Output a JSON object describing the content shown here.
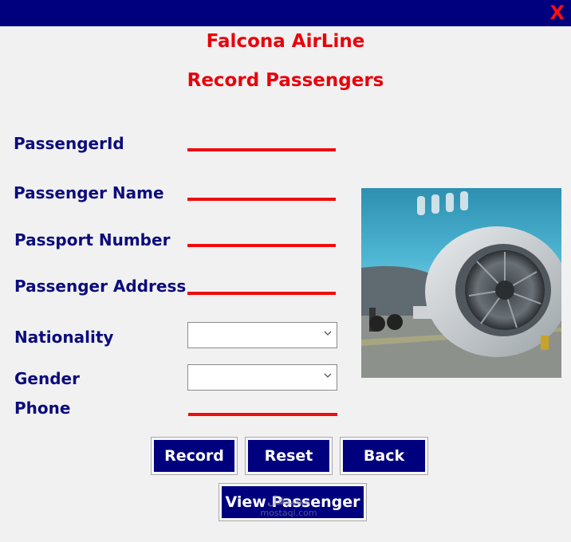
{
  "window": {
    "close_label": "X"
  },
  "header": {
    "app_title": "Falcona AirLine",
    "form_title": "Record Passengers"
  },
  "form": {
    "passenger_id_label": "PassengerId",
    "passenger_name_label": "Passenger Name",
    "passport_number_label": "Passport Number",
    "passenger_address_label": "Passenger Address",
    "nationality_label": "Nationality",
    "gender_label": "Gender",
    "phone_label": "Phone",
    "passenger_id_value": "",
    "passenger_name_value": "",
    "passport_number_value": "",
    "passenger_address_value": "",
    "nationality_value": "",
    "gender_value": "",
    "phone_value": ""
  },
  "buttons": {
    "record": "Record",
    "reset": "Reset",
    "back": "Back",
    "view_passenger": "View Passenger"
  },
  "watermark": {
    "text": "مستقل",
    "sub": "mostaql.com"
  },
  "colors": {
    "titlebar": "#00007f",
    "heading": "#e8000b",
    "label": "#0c0c7c",
    "input_line": "#ee0d0d",
    "button_bg": "#00007f",
    "background": "#f1f1f1"
  }
}
